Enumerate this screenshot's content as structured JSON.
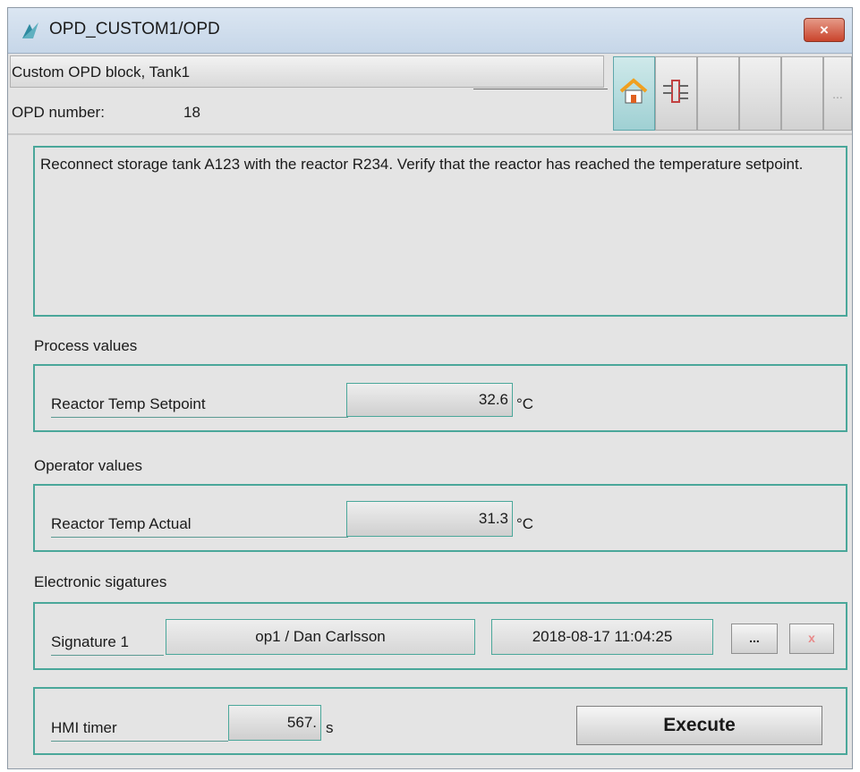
{
  "window": {
    "title": "OPD_CUSTOM1/OPD",
    "close_label": "×"
  },
  "header": {
    "block_name": "Custom OPD block, Tank1",
    "opd_number_label": "OPD number:",
    "opd_number": "18"
  },
  "toolbar": {
    "more_label": "..."
  },
  "description": "Reconnect storage tank A123 with the reactor R234. Verify that the reactor has reached the temperature setpoint.",
  "process_values": {
    "section_label": "Process values",
    "field_label": "Reactor Temp Setpoint",
    "value": "32.6",
    "unit": "°C"
  },
  "operator_values": {
    "section_label": "Operator values",
    "field_label": "Reactor Temp Actual",
    "value": "31.3",
    "unit": "°C"
  },
  "signatures": {
    "section_label": "Electronic sigatures",
    "field_label": "Signature 1",
    "user": "op1 / Dan Carlsson",
    "timestamp": "2018-08-17 11:04:25",
    "browse_label": "...",
    "clear_label": "x"
  },
  "timer": {
    "field_label": "HMI timer",
    "value": "567.",
    "unit": "s",
    "execute_label": "Execute"
  },
  "colors": {
    "accent": "#4aa79a",
    "titlebar": "#c6d6e8",
    "close": "#c9442c",
    "background": "#e4e4e4"
  }
}
